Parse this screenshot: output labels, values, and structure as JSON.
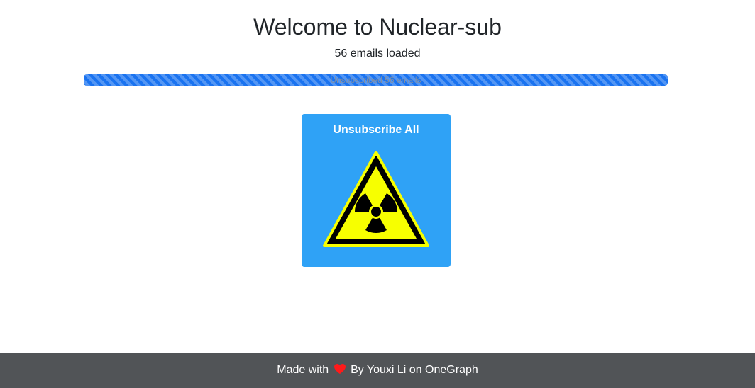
{
  "header": {
    "title": "Welcome to Nuclear-sub",
    "emails_loaded": "56 emails loaded"
  },
  "progress": {
    "label": "Unsubscribed 56 emails",
    "percent": 100,
    "color": "#1a73f0"
  },
  "action": {
    "label": "Unsubscribe All",
    "icon": "radiation-hazard-icon",
    "background": "#2fa2f6"
  },
  "footer": {
    "made_with": "Made with",
    "heart_icon": "heart-icon",
    "by_text": "By Youxi Li on",
    "link_text": "OneGraph"
  }
}
